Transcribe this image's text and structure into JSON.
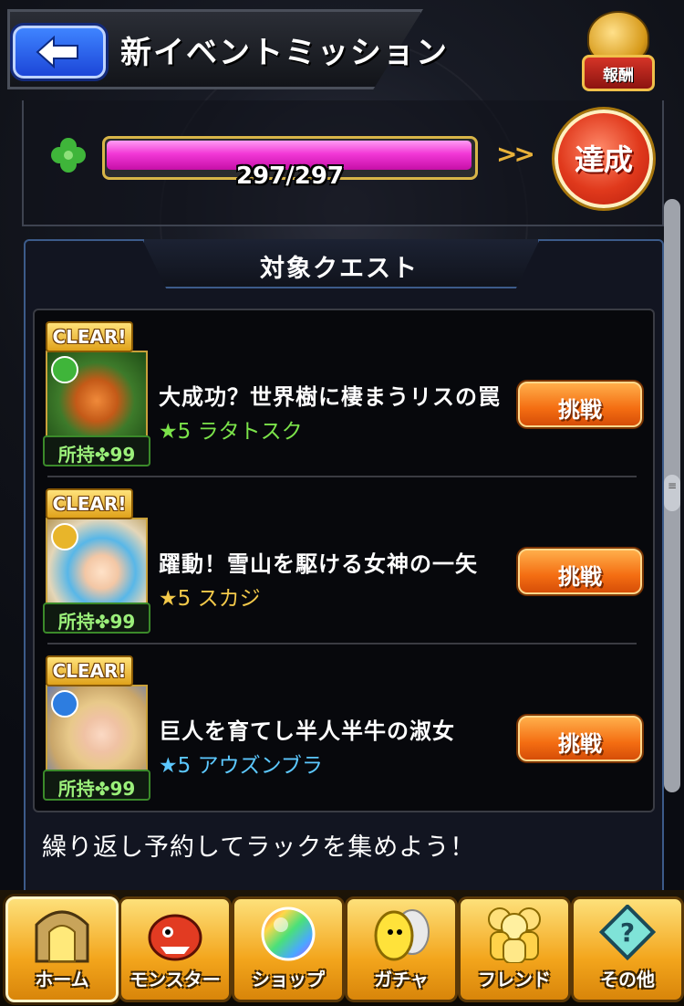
{
  "header": {
    "title": "新イベントミッション",
    "reward_label": "報酬"
  },
  "progress": {
    "text": "297/297",
    "fraction": 1.0,
    "achieved_label": "達成"
  },
  "quests": {
    "title": "対象クエスト",
    "items": [
      {
        "clear_label": "CLEAR!",
        "owned_label": "所持✤99",
        "name": "大成功？世界樹に棲まうリスの罠",
        "monster": "★5 ラタトスク",
        "monster_color": "#7be34a",
        "element": "wood",
        "element_color": "#3fb53a",
        "button_label": "挑戦"
      },
      {
        "clear_label": "CLEAR!",
        "owned_label": "所持✤99",
        "name": "躍動！雪山を駆ける女神の一矢",
        "monster": "★5 スカジ",
        "monster_color": "#f3c94a",
        "element": "light",
        "element_color": "#e8b52a",
        "button_label": "挑戦"
      },
      {
        "clear_label": "CLEAR!",
        "owned_label": "所持✤99",
        "name": "巨人を育てし半人半牛の淑女",
        "monster": "★5 アウズンブラ",
        "monster_color": "#5cc8ff",
        "element": "water",
        "element_color": "#2d7de0",
        "button_label": "挑戦"
      }
    ],
    "footer_message": "繰り返し予約してラックを集めよう！"
  },
  "nav": {
    "items": [
      {
        "label": "ホーム",
        "icon": "home-gate-icon"
      },
      {
        "label": "モンスター",
        "icon": "monster-icon"
      },
      {
        "label": "ショップ",
        "icon": "rainbow-orb-icon"
      },
      {
        "label": "ガチャ",
        "icon": "gacha-egg-icon"
      },
      {
        "label": "フレンド",
        "icon": "friends-icon"
      },
      {
        "label": "その他",
        "icon": "other-icon"
      }
    ]
  },
  "colors": {
    "progress_fill": "#f238d6",
    "button_orange": "#f46d12",
    "nav_gold": "#f3a51c",
    "clover_green": "#3fb53a"
  }
}
